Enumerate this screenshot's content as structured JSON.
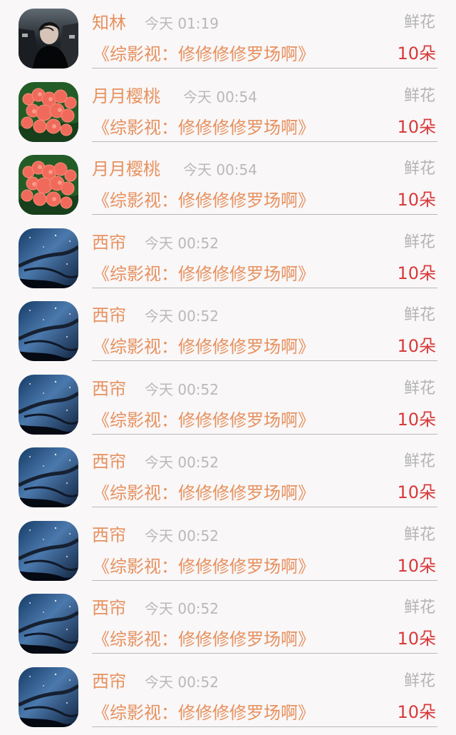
{
  "records": [
    {
      "user": "知林",
      "time": "今天 01:19",
      "gift_type": "鲜花",
      "book": "《综影视：修修修修罗场啊》",
      "count": "10朵",
      "avatar": "person-avatar"
    },
    {
      "user": "月月樱桃",
      "time": "今天 00:54",
      "gift_type": "鲜花",
      "book": "《综影视：修修修修罗场啊》",
      "count": "10朵",
      "avatar": "flower-avatar"
    },
    {
      "user": "月月樱桃",
      "time": "今天 00:54",
      "gift_type": "鲜花",
      "book": "《综影视：修修修修罗场啊》",
      "count": "10朵",
      "avatar": "flower-avatar"
    },
    {
      "user": "西帘",
      "time": "今天 00:52",
      "gift_type": "鲜花",
      "book": "《综影视：修修修修罗场啊》",
      "count": "10朵",
      "avatar": "night-sky-avatar"
    },
    {
      "user": "西帘",
      "time": "今天 00:52",
      "gift_type": "鲜花",
      "book": "《综影视：修修修修罗场啊》",
      "count": "10朵",
      "avatar": "night-sky-avatar"
    },
    {
      "user": "西帘",
      "time": "今天 00:52",
      "gift_type": "鲜花",
      "book": "《综影视：修修修修罗场啊》",
      "count": "10朵",
      "avatar": "night-sky-avatar"
    },
    {
      "user": "西帘",
      "time": "今天 00:52",
      "gift_type": "鲜花",
      "book": "《综影视：修修修修罗场啊》",
      "count": "10朵",
      "avatar": "night-sky-avatar"
    },
    {
      "user": "西帘",
      "time": "今天 00:52",
      "gift_type": "鲜花",
      "book": "《综影视：修修修修罗场啊》",
      "count": "10朵",
      "avatar": "night-sky-avatar"
    },
    {
      "user": "西帘",
      "time": "今天 00:52",
      "gift_type": "鲜花",
      "book": "《综影视：修修修修罗场啊》",
      "count": "10朵",
      "avatar": "night-sky-avatar"
    },
    {
      "user": "西帘",
      "time": "今天 00:52",
      "gift_type": "鲜花",
      "book": "《综影视：修修修修罗场啊》",
      "count": "10朵",
      "avatar": "night-sky-avatar"
    }
  ],
  "colors": {
    "background": "#f9f7f8",
    "accent_orange": "#e7915e",
    "count_red": "#d83a3a",
    "muted_gray": "#b9b9b9"
  }
}
